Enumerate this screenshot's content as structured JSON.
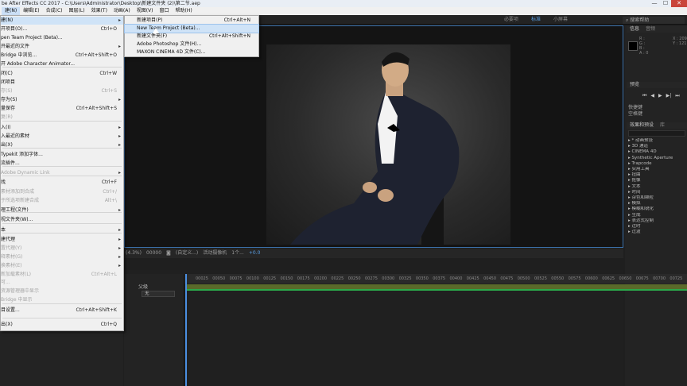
{
  "window": {
    "title": "be After Effects CC 2017 - C:\\Users\\Administrator\\Desktop\\新建文件夹 (2)\\第二节.aep",
    "min": "—",
    "max": "☐",
    "close": "✕"
  },
  "menubar": [
    "编辑(E)",
    "合成(C)",
    "图层(L)",
    "效果(T)",
    "动画(A)",
    "视图(V)",
    "窗口",
    "帮助(H)"
  ],
  "menubar_first": "建(N)",
  "workspaces": [
    "必要项",
    "标准",
    "小屏幕"
  ],
  "search_help": "搜索帮助",
  "file_menu": [
    {
      "label": "建(N)",
      "key": "",
      "arrow": "▸",
      "disabled": false,
      "hl": true
    },
    {
      "label": "开项目(O)...",
      "key": "Ctrl+O",
      "arrow": "",
      "disabled": false
    },
    {
      "label": "pen Team Project (Beta)...",
      "key": "",
      "arrow": "",
      "disabled": false
    },
    {
      "label": "开最近的文件",
      "key": "",
      "arrow": "▸",
      "disabled": false
    },
    {
      "label": "Bridge 中浏览...",
      "key": "Ctrl+Alt+Shift+O",
      "arrow": "",
      "disabled": false
    },
    {
      "label": "开 Adobe Character Animator...",
      "key": "",
      "arrow": "",
      "disabled": false
    },
    {
      "label": "闭(C)",
      "key": "Ctrl+W",
      "arrow": "",
      "disabled": false
    },
    {
      "label": "闭项目",
      "key": "",
      "arrow": "",
      "disabled": false
    },
    {
      "label": "存(S)",
      "key": "Ctrl+S",
      "arrow": "",
      "disabled": true
    },
    {
      "label": "存为(S)",
      "key": "",
      "arrow": "▸",
      "disabled": false
    },
    {
      "label": "量保存",
      "key": "Ctrl+Alt+Shift+S",
      "arrow": "",
      "disabled": false
    },
    {
      "label": "复(R)",
      "key": "",
      "arrow": "",
      "disabled": true
    },
    {
      "label": "入(I)",
      "key": "",
      "arrow": "▸",
      "disabled": false
    },
    {
      "label": "入最近的素材",
      "key": "",
      "arrow": "▸",
      "disabled": false
    },
    {
      "label": "出(X)",
      "key": "",
      "arrow": "▸",
      "disabled": false
    },
    {
      "label": "Typekit 添加字体...",
      "key": "",
      "arrow": "",
      "disabled": false
    },
    {
      "label": "流插件...",
      "key": "",
      "arrow": "",
      "disabled": false
    },
    {
      "label": "Adobe Dynamic Link",
      "key": "",
      "arrow": "▸",
      "disabled": true
    },
    {
      "label": "找",
      "key": "Ctrl+F",
      "arrow": "",
      "disabled": false
    },
    {
      "label": "素材添加到合成",
      "key": "Ctrl+/",
      "arrow": "",
      "disabled": true
    },
    {
      "label": "于所选项新建合成",
      "key": "Alt+\\",
      "arrow": "",
      "disabled": true
    },
    {
      "label": "理工程(文件)",
      "key": "",
      "arrow": "▸",
      "disabled": false
    },
    {
      "label": "视文件夹(W)...",
      "key": "",
      "arrow": "",
      "disabled": false
    },
    {
      "label": "本",
      "key": "",
      "arrow": "▸",
      "disabled": false
    },
    {
      "label": "建代理",
      "key": "",
      "arrow": "▸",
      "disabled": false
    },
    {
      "label": "置代理(Y)",
      "key": "",
      "arrow": "▸",
      "disabled": true
    },
    {
      "label": "释素材(G)",
      "key": "",
      "arrow": "▸",
      "disabled": true
    },
    {
      "label": "换素材(E)",
      "key": "",
      "arrow": "▸",
      "disabled": true
    },
    {
      "label": "新加载素材(L)",
      "key": "Ctrl+Alt+L",
      "arrow": "",
      "disabled": true
    },
    {
      "label": "可...",
      "key": "",
      "arrow": "",
      "disabled": true
    },
    {
      "label": "资源管理器中显示",
      "key": "",
      "arrow": "",
      "disabled": true
    },
    {
      "label": "Bridge 中显示",
      "key": "",
      "arrow": "",
      "disabled": true
    },
    {
      "label": "目设置...",
      "key": "Ctrl+Alt+Shift+K",
      "arrow": "",
      "disabled": false
    },
    {
      "label": "出(X)",
      "key": "Ctrl+Q",
      "arrow": "",
      "disabled": false
    }
  ],
  "new_submenu": [
    {
      "label": "新建项目(P)",
      "key": "Ctrl+Alt+N"
    },
    {
      "label": "New Team Project (Beta)...",
      "key": ""
    },
    {
      "label": "新建文件夹(F)",
      "key": "Ctrl+Alt+Shift+N"
    },
    {
      "label": "Adobe Photoshop 文件(H)...",
      "key": ""
    },
    {
      "label": "MAXON CINEMA 4D 文件(C)...",
      "key": ""
    }
  ],
  "comp_footer": [
    "(4.3%)",
    "00000",
    "(自定义...)",
    "活动摄像机",
    "1个..."
  ],
  "comp_footer_blue": "+0.0",
  "info_panel": {
    "tabs": [
      "信息",
      "音频"
    ],
    "rgb": [
      "R :",
      "G :",
      "B :",
      "A : 0"
    ],
    "xy": [
      "X : 209",
      "Y : 121"
    ]
  },
  "preview_panel": {
    "title": "预览",
    "controls": [
      "⏮",
      "◀",
      "▶",
      "▶|",
      "⏭"
    ]
  },
  "shortcut": {
    "label": "快捷键",
    "value": "空格键"
  },
  "effects_panel": {
    "tabs": [
      "效果和预设",
      "库"
    ],
    "items": [
      "▸ * 动画预设",
      "▸ 3D 通道",
      "▸ CINEMA 4D",
      "▸ Synthetic Aperture",
      "▸ Trapcode",
      "▸ 实用工具",
      "▸ 扭曲",
      "▸ 抠像",
      "▸ 文本",
      "▸ 时间",
      "▸ 杂色和颗粒",
      "▸ 模拟",
      "▸ 模糊和锐化",
      "▸ 生成",
      "▸ 表达式控制",
      "▸ 过时",
      "▸ 过渡"
    ]
  },
  "timeline": {
    "ruler": [
      "00025",
      "00050",
      "00075",
      "00100",
      "00125",
      "00150",
      "00175",
      "00200",
      "00225",
      "00250",
      "00275",
      "00300",
      "00325",
      "00350",
      "00375",
      "00400",
      "00425",
      "00450",
      "00475",
      "00500",
      "00525",
      "00550",
      "00575",
      "00600",
      "00625",
      "00650",
      "00675",
      "00700",
      "00725"
    ],
    "parent_header": "父级",
    "parent_value": "无"
  }
}
